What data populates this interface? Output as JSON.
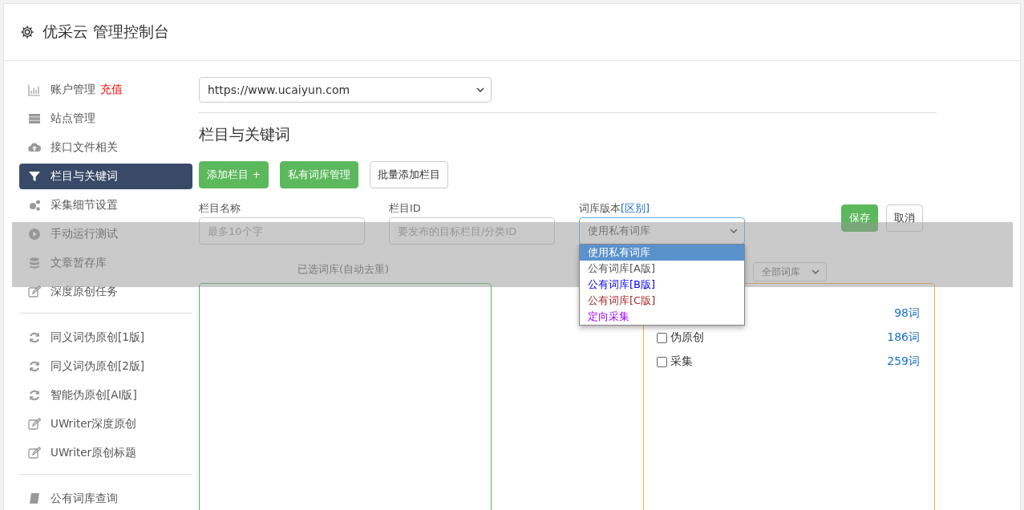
{
  "header": {
    "title": "优采云 管理控制台"
  },
  "sidebar": {
    "groups": [
      [
        {
          "label": "账户管理",
          "badge": "充值",
          "selected": false
        },
        {
          "label": "站点管理",
          "selected": false
        },
        {
          "label": "接口文件相关",
          "selected": false
        },
        {
          "label": "栏目与关键词",
          "selected": true
        },
        {
          "label": "采集细节设置",
          "selected": false
        },
        {
          "label": "手动运行测试",
          "selected": false
        },
        {
          "label": "文章暂存库",
          "selected": false
        },
        {
          "label": "深度原创任务",
          "selected": false
        }
      ],
      [
        {
          "label": "同义词伪原创[1版]",
          "selected": false
        },
        {
          "label": "同义词伪原创[2版]",
          "selected": false
        },
        {
          "label": "智能伪原创[AI版]",
          "selected": false
        },
        {
          "label": "UWriter深度原创",
          "selected": false
        },
        {
          "label": "UWriter原创标题",
          "selected": false
        }
      ],
      [
        {
          "label": "公有词库查询",
          "selected": false
        }
      ]
    ]
  },
  "site_select": {
    "value": "https://www.ucaiyun.com"
  },
  "section_title": "栏目与关键词",
  "buttons": [
    {
      "label": "添加栏目 +",
      "kind": "primary"
    },
    {
      "label": "私有词库管理",
      "kind": "primary"
    },
    {
      "label": "批量添加栏目",
      "kind": "default"
    }
  ],
  "form": {
    "name_field": {
      "label": "栏目名称",
      "placeholder": "最多10个字"
    },
    "id_field": {
      "label": "栏目ID",
      "placeholder": "要发布的目标栏目/分类ID"
    },
    "version_field": {
      "label": "词库版本",
      "link": "[区别]",
      "value": "使用私有词库",
      "options": [
        {
          "label": "使用私有词库",
          "selected": true
        },
        {
          "label": "公有词库[A版]",
          "selected": false,
          "color": "#555555"
        },
        {
          "label": "公有词库[B版]",
          "selected": false,
          "color": "#0000ff"
        },
        {
          "label": "公有词库[C版]",
          "selected": false,
          "color": "#a52a2a"
        },
        {
          "label": "定向采集",
          "selected": false,
          "color": "#9900ff"
        }
      ]
    },
    "save": "保存",
    "cancel": "取消"
  },
  "selected_libraries": {
    "title": "已选词库(自动去重)"
  },
  "library_filter": {
    "value": "全部词库"
  },
  "libraries": [
    {
      "count": "98词"
    },
    {
      "label": "伪原创",
      "count": "186词",
      "checked": false
    },
    {
      "label": "采集",
      "count": "259词",
      "checked": false
    }
  ]
}
